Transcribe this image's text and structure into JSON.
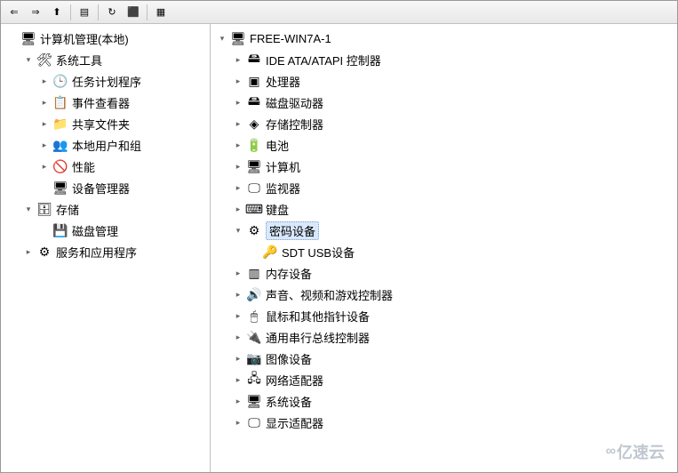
{
  "toolbar_icons": {
    "back": "⇐",
    "forward": "⇒",
    "up": "⬆",
    "props": "▤",
    "refresh": "↻",
    "stop": "⬛",
    "list": "▦"
  },
  "left_tree": {
    "root": {
      "label": "计算机管理(本地)",
      "expander": "▾"
    },
    "system_tools": {
      "label": "系统工具",
      "expander": "▾"
    },
    "st_items": [
      {
        "label": "任务计划程序",
        "icon": "🕒",
        "expander": "▸"
      },
      {
        "label": "事件查看器",
        "icon": "📋",
        "expander": "▸"
      },
      {
        "label": "共享文件夹",
        "icon": "📁",
        "expander": "▸"
      },
      {
        "label": "本地用户和组",
        "icon": "👥",
        "expander": "▸"
      },
      {
        "label": "性能",
        "icon": "🚫",
        "expander": "▸"
      }
    ],
    "device_manager": {
      "label": "设备管理器",
      "icon": "🖥"
    },
    "storage": {
      "label": "存储",
      "icon": "🗄",
      "expander": "▾"
    },
    "disk_mgmt": {
      "label": "磁盘管理",
      "icon": "💾"
    },
    "services": {
      "label": "服务和应用程序",
      "icon": "⚙",
      "expander": "▸"
    }
  },
  "right_tree": {
    "root": {
      "label": "FREE-WIN7A-1",
      "icon": "🖥",
      "expander": "▾"
    },
    "items": [
      {
        "label": "IDE ATA/ATAPI 控制器",
        "icon": "🖴",
        "expander": "▸"
      },
      {
        "label": "处理器",
        "icon": "▣",
        "expander": "▸"
      },
      {
        "label": "磁盘驱动器",
        "icon": "🖴",
        "expander": "▸"
      },
      {
        "label": "存储控制器",
        "icon": "◈",
        "expander": "▸"
      },
      {
        "label": "电池",
        "icon": "🔋",
        "expander": "▸"
      },
      {
        "label": "计算机",
        "icon": "🖥",
        "expander": "▸"
      },
      {
        "label": "监视器",
        "icon": "🖵",
        "expander": "▸"
      },
      {
        "label": "键盘",
        "icon": "⌨",
        "expander": "▸"
      }
    ],
    "crypto": {
      "label": "密码设备",
      "icon": "⚙",
      "expander": "▾",
      "selected": true
    },
    "crypto_child": {
      "label": "SDT USB设备",
      "icon": "🔑"
    },
    "items2": [
      {
        "label": "内存设备",
        "icon": "▥",
        "expander": "▸"
      },
      {
        "label": "声音、视频和游戏控制器",
        "icon": "🔊",
        "expander": "▸"
      },
      {
        "label": "鼠标和其他指针设备",
        "icon": "🖱",
        "expander": "▸"
      },
      {
        "label": "通用串行总线控制器",
        "icon": "🔌",
        "expander": "▸"
      },
      {
        "label": "图像设备",
        "icon": "📷",
        "expander": "▸"
      },
      {
        "label": "网络适配器",
        "icon": "🖧",
        "expander": "▸"
      },
      {
        "label": "系统设备",
        "icon": "🖥",
        "expander": "▸"
      },
      {
        "label": "显示适配器",
        "icon": "🖵",
        "expander": "▸"
      }
    ]
  },
  "watermark": "亿速云"
}
